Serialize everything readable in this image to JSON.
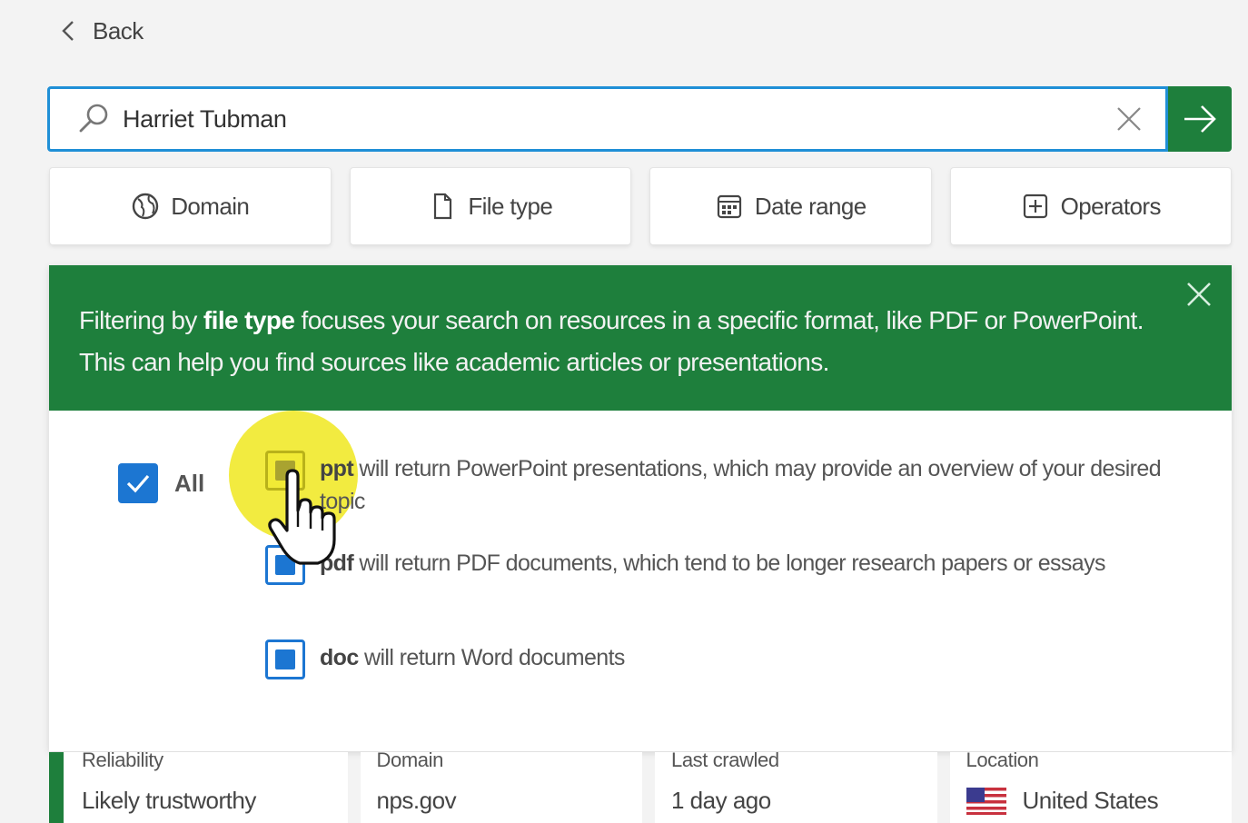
{
  "nav": {
    "back_label": "Back"
  },
  "search": {
    "value": "Harriet Tubman",
    "placeholder": ""
  },
  "filters": [
    {
      "label": "Domain",
      "icon": "globe-icon"
    },
    {
      "label": "File type",
      "icon": "file-icon"
    },
    {
      "label": "Date range",
      "icon": "calendar-icon"
    },
    {
      "label": "Operators",
      "icon": "plus-box-icon"
    }
  ],
  "banner": {
    "prefix": "Filtering by ",
    "emphasis": "file type",
    "suffix": " focuses your search on resources in a specific format, like PDF or PowerPoint. This can help you find sources like academic articles or presentations."
  },
  "file_types": {
    "all_label": "All",
    "all_checked": true,
    "options": [
      {
        "key": "ppt",
        "description": " will return PowerPoint presentations, which may provide an overview of your desired topic",
        "checked": true
      },
      {
        "key": "pdf",
        "description": " will return PDF documents, which tend to be longer research papers or essays",
        "checked": true
      },
      {
        "key": "doc",
        "description": " will return Word documents",
        "checked": true
      }
    ]
  },
  "result": {
    "reliability_label": "Reliability",
    "reliability_value": "Likely trustworthy",
    "domain_label": "Domain",
    "domain_value": "nps.gov",
    "crawled_label": "Last crawled",
    "crawled_value": "1 day ago",
    "location_label": "Location",
    "location_value": "United States",
    "location_icon": "us-flag-icon"
  },
  "colors": {
    "accent_green": "#1e7f3c",
    "accent_blue": "#1c76d2",
    "focus_blue": "#1f8fd6"
  }
}
